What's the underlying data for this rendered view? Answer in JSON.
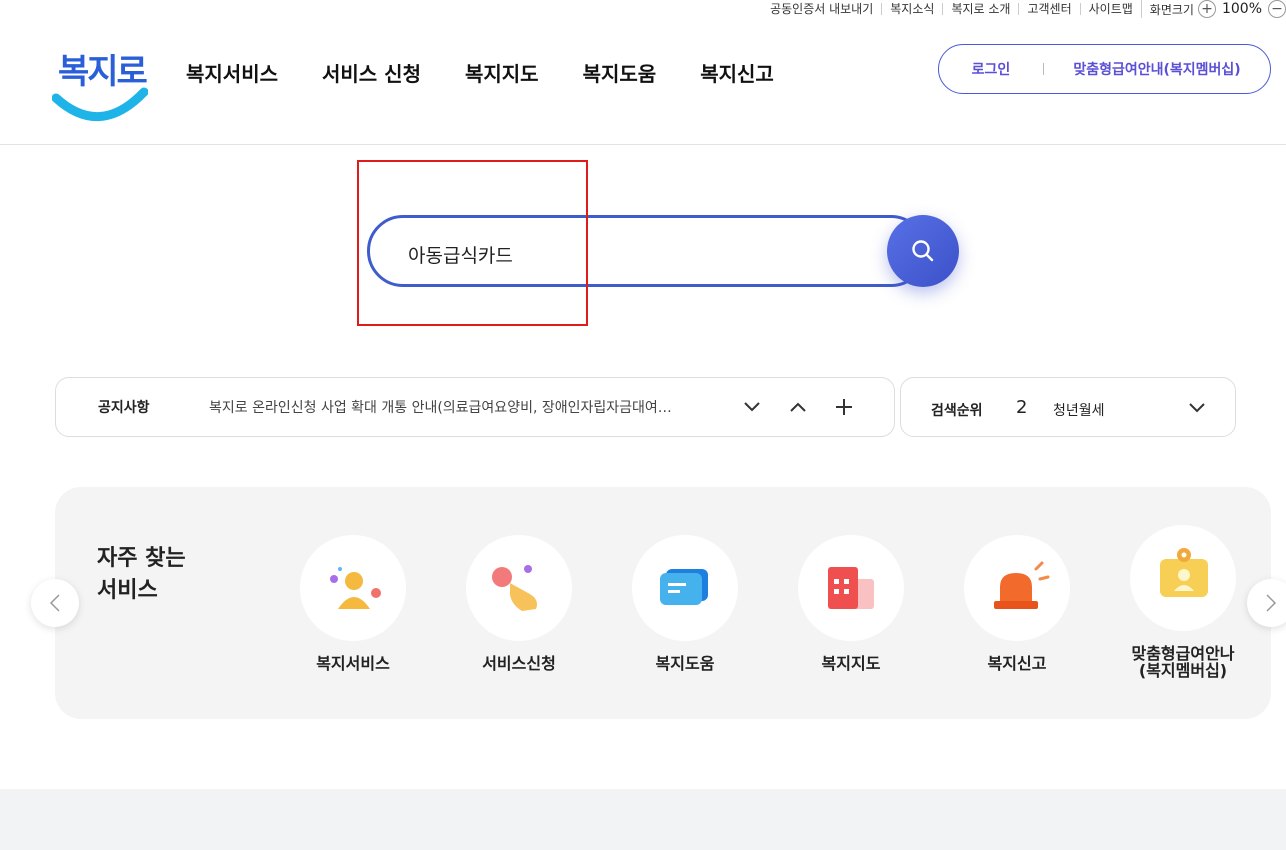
{
  "util_links": [
    "공동인증서 내보내기",
    "복지소식",
    "복지로 소개",
    "고객센터",
    "사이트맵"
  ],
  "zoom": {
    "label": "화면크기",
    "plus": "+",
    "value": "100%",
    "minus": "−"
  },
  "logo": {
    "text": "복지로"
  },
  "gnb": [
    "복지서비스",
    "서비스 신청",
    "복지지도",
    "복지도움",
    "복지신고"
  ],
  "auth": {
    "login": "로그인",
    "member": "맞춤형급여안내(복지멤버십)"
  },
  "search": {
    "value": "아동급식카드",
    "icon": "search-icon"
  },
  "notice": {
    "label": "공지사항",
    "text": "복지로 온라인신청 사업 확대 개통 안내(의료급여요양비, 장애인자립자금대여…"
  },
  "rank": {
    "label": "검색순위",
    "number": "2",
    "term": "청년월세"
  },
  "quick": {
    "title": "자주 찾는\n서비스",
    "items": [
      {
        "label": "복지서비스",
        "icon": "person-icon"
      },
      {
        "label": "서비스신청",
        "icon": "hand-click-icon"
      },
      {
        "label": "복지도움",
        "icon": "chat-bubble-icon"
      },
      {
        "label": "복지지도",
        "icon": "map-building-icon"
      },
      {
        "label": "복지신고",
        "icon": "siren-icon"
      },
      {
        "label": "맞춤형급여안나\n(복지멤버십)",
        "icon": "member-card-icon"
      }
    ]
  },
  "colors": {
    "brand": "#3f5ccc",
    "accent": "#5b4fd6",
    "highlight": "#e01b1b"
  }
}
